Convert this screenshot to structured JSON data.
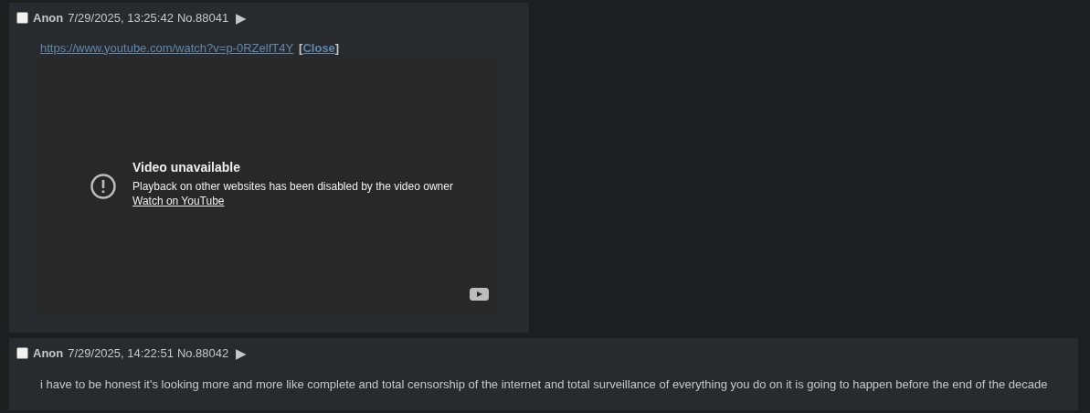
{
  "posts": [
    {
      "kind": "embed",
      "checked": false,
      "name": "Anon",
      "date": "7/29/2025, 13:25:42",
      "number": "No.88041",
      "expand": "▶",
      "link": "https://www.youtube.com/watch?v=p-0RZelfT4Y",
      "close_open": "[",
      "close": "Close",
      "close_end": "]",
      "video": {
        "title": "Video unavailable",
        "message": "Playback on other websites has been disabled by the video owner",
        "watch_link": "Watch on YouTube"
      }
    },
    {
      "kind": "text",
      "checked": false,
      "name": "Anon",
      "date": "7/29/2025, 14:22:51",
      "number": "No.88042",
      "expand": "▶",
      "comment": "i have to be honest it's looking more and more like complete and total censorship of the internet and total surveillance of everything you do on it is going to happen before the end of the decade"
    }
  ]
}
